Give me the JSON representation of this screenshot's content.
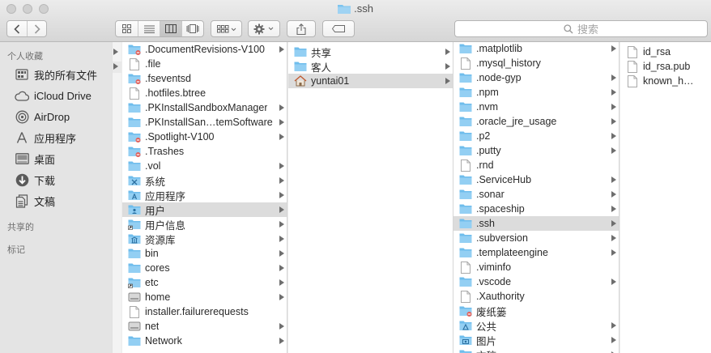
{
  "window": {
    "title": ".ssh"
  },
  "toolbar": {
    "back_label": "‹",
    "forward_label": "›",
    "search_placeholder": "搜索"
  },
  "sidebar": {
    "favorites_header": "个人收藏",
    "shared_header": "共享的",
    "tags_header": "标记",
    "items": [
      {
        "label": "我的所有文件",
        "icon": "all-files-icon"
      },
      {
        "label": "iCloud Drive",
        "icon": "cloud-icon"
      },
      {
        "label": "AirDrop",
        "icon": "airdrop-icon"
      },
      {
        "label": "应用程序",
        "icon": "applications-icon"
      },
      {
        "label": "桌面",
        "icon": "desktop-icon"
      },
      {
        "label": "下载",
        "icon": "downloads-icon"
      },
      {
        "label": "文稿",
        "icon": "documents-icon"
      }
    ]
  },
  "column1": {
    "items": [
      {
        "name": ".DocumentRevisions-V100",
        "type": "folder-restricted",
        "hidden": true,
        "arrow": true
      },
      {
        "name": ".file",
        "type": "file",
        "hidden": true,
        "arrow": false
      },
      {
        "name": ".fseventsd",
        "type": "folder-restricted",
        "hidden": true,
        "arrow": false
      },
      {
        "name": ".hotfiles.btree",
        "type": "file",
        "hidden": true,
        "arrow": false
      },
      {
        "name": ".PKInstallSandboxManager",
        "type": "folder",
        "hidden": true,
        "arrow": true
      },
      {
        "name": ".PKInstallSan…temSoftware",
        "type": "folder",
        "hidden": true,
        "arrow": true
      },
      {
        "name": ".Spotlight-V100",
        "type": "folder-restricted",
        "hidden": true,
        "arrow": true
      },
      {
        "name": ".Trashes",
        "type": "folder-trash",
        "hidden": true,
        "arrow": false
      },
      {
        "name": ".vol",
        "type": "folder",
        "hidden": true,
        "arrow": true
      },
      {
        "name": "系统",
        "type": "folder-system",
        "hidden": false,
        "arrow": true
      },
      {
        "name": "应用程序",
        "type": "folder-apps",
        "hidden": false,
        "arrow": true
      },
      {
        "name": "用户",
        "type": "folder-users",
        "hidden": false,
        "arrow": true,
        "selected": true
      },
      {
        "name": "用户信息",
        "type": "folder-alias",
        "hidden": false,
        "arrow": true
      },
      {
        "name": "资源库",
        "type": "folder-library",
        "hidden": false,
        "arrow": true
      },
      {
        "name": "bin",
        "type": "folder",
        "hidden": false,
        "arrow": true
      },
      {
        "name": "cores",
        "type": "folder",
        "hidden": false,
        "arrow": true
      },
      {
        "name": "etc",
        "type": "folder-alias",
        "hidden": false,
        "arrow": true
      },
      {
        "name": "home",
        "type": "drive",
        "hidden": false,
        "arrow": true
      },
      {
        "name": "installer.failurerequests",
        "type": "file",
        "hidden": false,
        "arrow": false
      },
      {
        "name": "net",
        "type": "drive",
        "hidden": false,
        "arrow": true
      },
      {
        "name": "Network",
        "type": "folder",
        "hidden": false,
        "arrow": true
      }
    ]
  },
  "column2": {
    "items": [
      {
        "name": "共享",
        "type": "folder",
        "arrow": true
      },
      {
        "name": "客人",
        "type": "folder",
        "arrow": true
      },
      {
        "name": "yuntai01",
        "type": "home",
        "arrow": true,
        "selected": true
      }
    ]
  },
  "column3": {
    "items": [
      {
        "name": ".matplotlib",
        "type": "folder",
        "arrow": true
      },
      {
        "name": ".mysql_history",
        "type": "file",
        "arrow": false
      },
      {
        "name": ".node-gyp",
        "type": "folder",
        "arrow": true
      },
      {
        "name": ".npm",
        "type": "folder",
        "arrow": true
      },
      {
        "name": ".nvm",
        "type": "folder",
        "arrow": true
      },
      {
        "name": ".oracle_jre_usage",
        "type": "folder",
        "arrow": true
      },
      {
        "name": ".p2",
        "type": "folder",
        "arrow": true
      },
      {
        "name": ".putty",
        "type": "folder",
        "arrow": true
      },
      {
        "name": ".rnd",
        "type": "file",
        "arrow": false
      },
      {
        "name": ".ServiceHub",
        "type": "folder",
        "arrow": true
      },
      {
        "name": ".sonar",
        "type": "folder",
        "arrow": true
      },
      {
        "name": ".spaceship",
        "type": "folder",
        "arrow": true
      },
      {
        "name": ".ssh",
        "type": "folder",
        "arrow": true,
        "selected": true
      },
      {
        "name": ".subversion",
        "type": "folder",
        "arrow": true
      },
      {
        "name": ".templateengine",
        "type": "folder",
        "arrow": true
      },
      {
        "name": ".viminfo",
        "type": "file",
        "arrow": false
      },
      {
        "name": ".vscode",
        "type": "folder",
        "arrow": true
      },
      {
        "name": ".Xauthority",
        "type": "file",
        "arrow": false
      },
      {
        "name": "废纸篓",
        "type": "folder-trash",
        "arrow": false
      },
      {
        "name": "公共",
        "type": "folder-public",
        "arrow": true
      },
      {
        "name": "图片",
        "type": "folder-pictures",
        "arrow": true
      },
      {
        "name": "文稿",
        "type": "folder-documents",
        "arrow": true
      }
    ]
  },
  "column4": {
    "items": [
      {
        "name": "id_rsa",
        "type": "file"
      },
      {
        "name": "id_rsa.pub",
        "type": "file"
      },
      {
        "name": "known_hosts",
        "type": "file"
      }
    ]
  },
  "colors": {
    "folder": "#7cc3ee",
    "folder_dark": "#5aaee0",
    "selection": "#dcdcdc",
    "restricted_badge": "#e0605a"
  }
}
